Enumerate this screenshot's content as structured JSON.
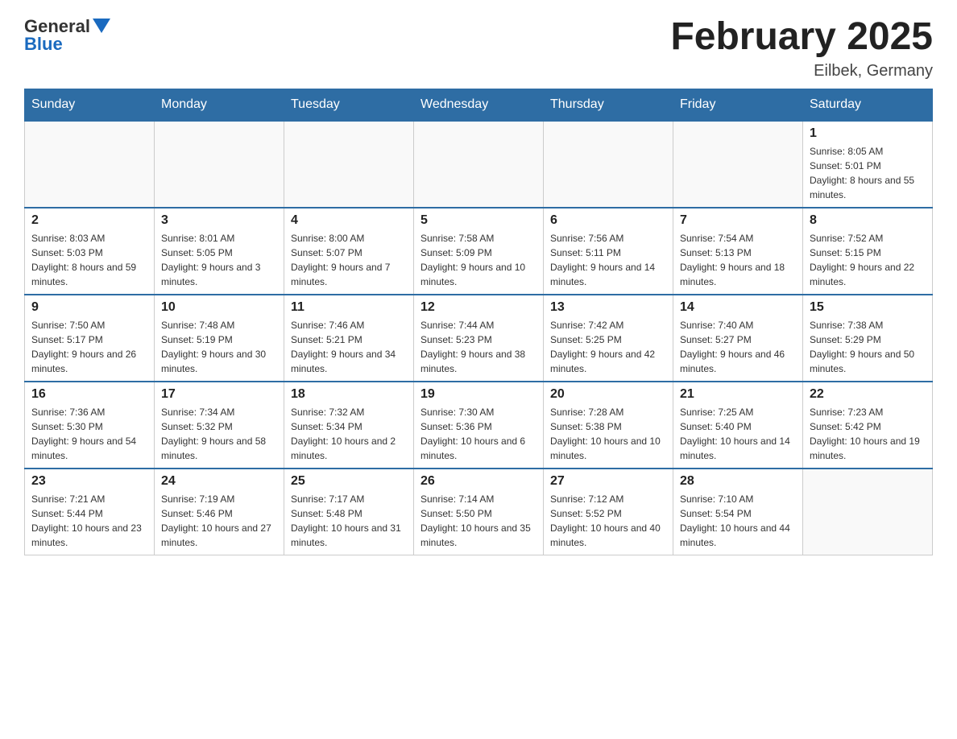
{
  "logo": {
    "text_general": "General",
    "text_blue": "Blue"
  },
  "header": {
    "title": "February 2025",
    "subtitle": "Eilbek, Germany"
  },
  "days_of_week": [
    "Sunday",
    "Monday",
    "Tuesday",
    "Wednesday",
    "Thursday",
    "Friday",
    "Saturday"
  ],
  "weeks": [
    [
      {
        "day": "",
        "info": ""
      },
      {
        "day": "",
        "info": ""
      },
      {
        "day": "",
        "info": ""
      },
      {
        "day": "",
        "info": ""
      },
      {
        "day": "",
        "info": ""
      },
      {
        "day": "",
        "info": ""
      },
      {
        "day": "1",
        "info": "Sunrise: 8:05 AM\nSunset: 5:01 PM\nDaylight: 8 hours and 55 minutes."
      }
    ],
    [
      {
        "day": "2",
        "info": "Sunrise: 8:03 AM\nSunset: 5:03 PM\nDaylight: 8 hours and 59 minutes."
      },
      {
        "day": "3",
        "info": "Sunrise: 8:01 AM\nSunset: 5:05 PM\nDaylight: 9 hours and 3 minutes."
      },
      {
        "day": "4",
        "info": "Sunrise: 8:00 AM\nSunset: 5:07 PM\nDaylight: 9 hours and 7 minutes."
      },
      {
        "day": "5",
        "info": "Sunrise: 7:58 AM\nSunset: 5:09 PM\nDaylight: 9 hours and 10 minutes."
      },
      {
        "day": "6",
        "info": "Sunrise: 7:56 AM\nSunset: 5:11 PM\nDaylight: 9 hours and 14 minutes."
      },
      {
        "day": "7",
        "info": "Sunrise: 7:54 AM\nSunset: 5:13 PM\nDaylight: 9 hours and 18 minutes."
      },
      {
        "day": "8",
        "info": "Sunrise: 7:52 AM\nSunset: 5:15 PM\nDaylight: 9 hours and 22 minutes."
      }
    ],
    [
      {
        "day": "9",
        "info": "Sunrise: 7:50 AM\nSunset: 5:17 PM\nDaylight: 9 hours and 26 minutes."
      },
      {
        "day": "10",
        "info": "Sunrise: 7:48 AM\nSunset: 5:19 PM\nDaylight: 9 hours and 30 minutes."
      },
      {
        "day": "11",
        "info": "Sunrise: 7:46 AM\nSunset: 5:21 PM\nDaylight: 9 hours and 34 minutes."
      },
      {
        "day": "12",
        "info": "Sunrise: 7:44 AM\nSunset: 5:23 PM\nDaylight: 9 hours and 38 minutes."
      },
      {
        "day": "13",
        "info": "Sunrise: 7:42 AM\nSunset: 5:25 PM\nDaylight: 9 hours and 42 minutes."
      },
      {
        "day": "14",
        "info": "Sunrise: 7:40 AM\nSunset: 5:27 PM\nDaylight: 9 hours and 46 minutes."
      },
      {
        "day": "15",
        "info": "Sunrise: 7:38 AM\nSunset: 5:29 PM\nDaylight: 9 hours and 50 minutes."
      }
    ],
    [
      {
        "day": "16",
        "info": "Sunrise: 7:36 AM\nSunset: 5:30 PM\nDaylight: 9 hours and 54 minutes."
      },
      {
        "day": "17",
        "info": "Sunrise: 7:34 AM\nSunset: 5:32 PM\nDaylight: 9 hours and 58 minutes."
      },
      {
        "day": "18",
        "info": "Sunrise: 7:32 AM\nSunset: 5:34 PM\nDaylight: 10 hours and 2 minutes."
      },
      {
        "day": "19",
        "info": "Sunrise: 7:30 AM\nSunset: 5:36 PM\nDaylight: 10 hours and 6 minutes."
      },
      {
        "day": "20",
        "info": "Sunrise: 7:28 AM\nSunset: 5:38 PM\nDaylight: 10 hours and 10 minutes."
      },
      {
        "day": "21",
        "info": "Sunrise: 7:25 AM\nSunset: 5:40 PM\nDaylight: 10 hours and 14 minutes."
      },
      {
        "day": "22",
        "info": "Sunrise: 7:23 AM\nSunset: 5:42 PM\nDaylight: 10 hours and 19 minutes."
      }
    ],
    [
      {
        "day": "23",
        "info": "Sunrise: 7:21 AM\nSunset: 5:44 PM\nDaylight: 10 hours and 23 minutes."
      },
      {
        "day": "24",
        "info": "Sunrise: 7:19 AM\nSunset: 5:46 PM\nDaylight: 10 hours and 27 minutes."
      },
      {
        "day": "25",
        "info": "Sunrise: 7:17 AM\nSunset: 5:48 PM\nDaylight: 10 hours and 31 minutes."
      },
      {
        "day": "26",
        "info": "Sunrise: 7:14 AM\nSunset: 5:50 PM\nDaylight: 10 hours and 35 minutes."
      },
      {
        "day": "27",
        "info": "Sunrise: 7:12 AM\nSunset: 5:52 PM\nDaylight: 10 hours and 40 minutes."
      },
      {
        "day": "28",
        "info": "Sunrise: 7:10 AM\nSunset: 5:54 PM\nDaylight: 10 hours and 44 minutes."
      },
      {
        "day": "",
        "info": ""
      }
    ]
  ]
}
